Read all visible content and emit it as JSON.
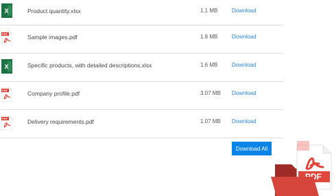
{
  "files": [
    {
      "name": "Product quantity.xlsx",
      "size": "1.1 MB",
      "type": "xlsx",
      "action": "Download"
    },
    {
      "name": "Sample images.pdf",
      "size": "1.8 MB",
      "type": "pdf",
      "action": "Download"
    },
    {
      "name": "Specific products, with detailed descriptions.xlsx",
      "size": "1.6 MB",
      "type": "xlsx",
      "action": "Download"
    },
    {
      "name": "Company profile.pdf",
      "size": "3.07 MB",
      "type": "pdf",
      "action": "Download"
    },
    {
      "name": "Delivery requirements.pdf",
      "size": "1.07 MB",
      "type": "pdf",
      "action": "Download"
    }
  ],
  "download_all_label": "Download All",
  "icons": {
    "xlsx": "excel-file-icon",
    "pdf": "pdf-file-icon",
    "corner": "pdf-folder-icon"
  },
  "colors": {
    "link": "#2a86d6",
    "button": "#0a84e6",
    "excel": "#1e7145",
    "pdf_red": "#d93a2f"
  }
}
